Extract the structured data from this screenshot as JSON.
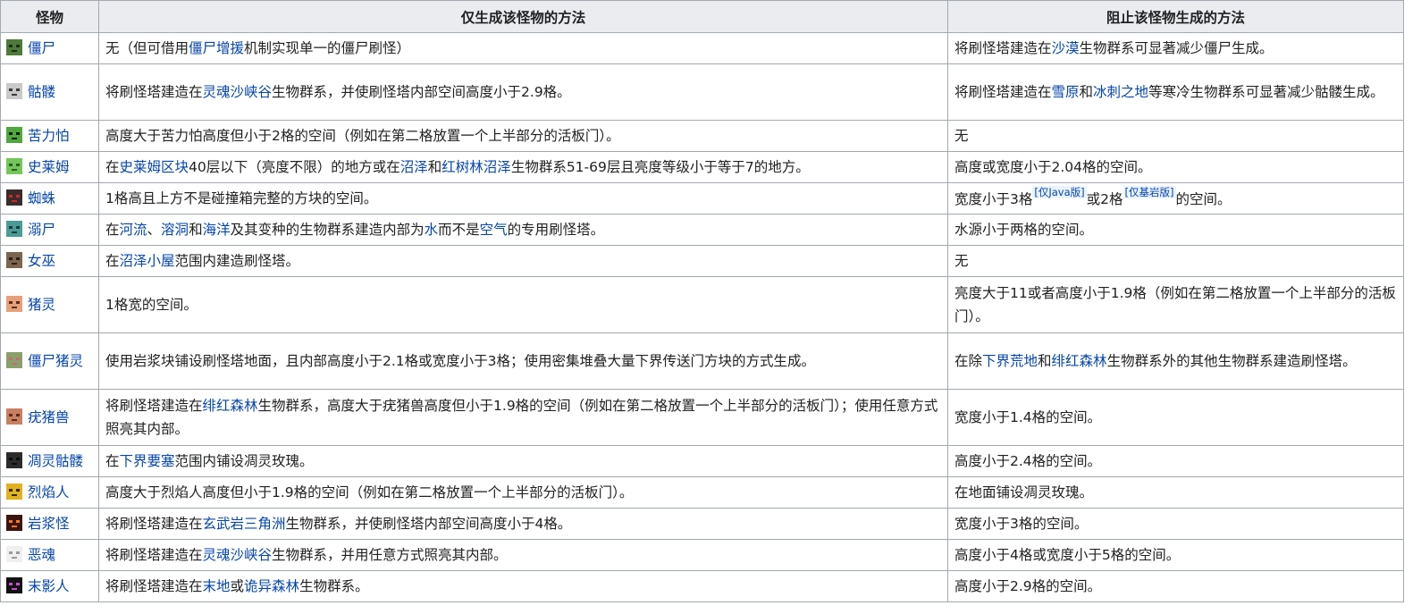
{
  "headers": {
    "mob": "怪物",
    "only": "仅生成该怪物的方法",
    "prevent": "阻止该怪物生成的方法"
  },
  "rows": [
    {
      "icon": "zombie-face-icon",
      "name": "僵尸",
      "only": [
        {
          "t": "无（但可借用"
        },
        {
          "t": "僵尸增援",
          "l": 1
        },
        {
          "t": "机制实现单一的僵尸刷怪）"
        }
      ],
      "prevent": [
        {
          "t": "将刷怪塔建造在"
        },
        {
          "t": "沙漠",
          "l": 1
        },
        {
          "t": "生物群系可显著减少僵尸生成。"
        }
      ]
    },
    {
      "icon": "skeleton-face-icon",
      "name": "骷髅",
      "only": [
        {
          "t": "将刷怪塔建造在"
        },
        {
          "t": "灵魂沙峡谷",
          "l": 1
        },
        {
          "t": "生物群系，并使刷怪塔内部空间高度小于2.9格。"
        }
      ],
      "prevent": [
        {
          "t": "将刷怪塔建造在"
        },
        {
          "t": "雪原",
          "l": 1
        },
        {
          "t": "和"
        },
        {
          "t": "冰刺之地",
          "l": 1
        },
        {
          "t": "等寒冷生物群系可显著减少骷髅生成。"
        }
      ]
    },
    {
      "icon": "creeper-face-icon",
      "name": "苦力怕",
      "only": [
        {
          "t": "高度大于苦力怕高度但小于2格的空间（例如在第二格放置一个上半部分的活板门）。"
        }
      ],
      "prevent": [
        {
          "t": "无"
        }
      ]
    },
    {
      "icon": "slime-face-icon",
      "name": "史莱姆",
      "only": [
        {
          "t": "在"
        },
        {
          "t": "史莱姆区块",
          "l": 1
        },
        {
          "t": "40层以下（亮度不限）的地方或在"
        },
        {
          "t": "沼泽",
          "l": 1
        },
        {
          "t": "和"
        },
        {
          "t": "红树林沼泽",
          "l": 1
        },
        {
          "t": "生物群系51-69层且亮度等级小于等于7的地方。"
        }
      ],
      "prevent": [
        {
          "t": "高度或宽度小于2.04格的空间。"
        }
      ]
    },
    {
      "icon": "spider-face-icon",
      "name": "蜘蛛",
      "only": [
        {
          "t": "1格高且上方不是碰撞箱完整的方块的空间。"
        }
      ],
      "prevent": [
        {
          "t": "宽度小于3格"
        },
        {
          "t": "[仅Java版]",
          "s": 1
        },
        {
          "t": "或2格"
        },
        {
          "t": "[仅基岩版]",
          "s": 1
        },
        {
          "t": "的空间。"
        }
      ]
    },
    {
      "icon": "drowned-face-icon",
      "name": "溺尸",
      "only": [
        {
          "t": "在"
        },
        {
          "t": "河流",
          "l": 1
        },
        {
          "t": "、"
        },
        {
          "t": "溶洞",
          "l": 1
        },
        {
          "t": "和"
        },
        {
          "t": "海洋",
          "l": 1
        },
        {
          "t": "及其变种的生物群系建造内部为"
        },
        {
          "t": "水",
          "l": 1
        },
        {
          "t": "而不是"
        },
        {
          "t": "空气",
          "l": 1
        },
        {
          "t": "的专用刷怪塔。"
        }
      ],
      "prevent": [
        {
          "t": "水源小于两格的空间。"
        }
      ]
    },
    {
      "icon": "witch-face-icon",
      "name": "女巫",
      "only": [
        {
          "t": "在"
        },
        {
          "t": "沼泽小屋",
          "l": 1
        },
        {
          "t": "范围内建造刷怪塔。"
        }
      ],
      "prevent": [
        {
          "t": "无"
        }
      ]
    },
    {
      "icon": "piglin-face-icon",
      "name": "猪灵",
      "only": [
        {
          "t": "1格宽的空间。"
        }
      ],
      "prevent": [
        {
          "t": "亮度大于11或者高度小于1.9格（例如在第二格放置一个上半部分的活板门）。"
        }
      ]
    },
    {
      "icon": "zombified-piglin-face-icon",
      "name": "僵尸猪灵",
      "only": [
        {
          "t": "使用岩浆块铺设刷怪塔地面，且内部高度小于2.1格或宽度小于3格；使用密集堆叠大量下界传送门方块的方式生成。"
        }
      ],
      "prevent": [
        {
          "t": "在除"
        },
        {
          "t": "下界荒地",
          "l": 1
        },
        {
          "t": "和"
        },
        {
          "t": "绯红森林",
          "l": 1
        },
        {
          "t": "生物群系外的其他生物群系建造刷怪塔。"
        }
      ]
    },
    {
      "icon": "hoglin-face-icon",
      "name": "疣猪兽",
      "only": [
        {
          "t": "将刷怪塔建造在"
        },
        {
          "t": "绯红森林",
          "l": 1
        },
        {
          "t": "生物群系，高度大于疣猪兽高度但小于1.9格的空间（例如在第二格放置一个上半部分的活板门）；使用任意方式照亮其内部。"
        }
      ],
      "prevent": [
        {
          "t": "宽度小于1.4格的空间。"
        }
      ]
    },
    {
      "icon": "wither-skeleton-face-icon",
      "name": "凋灵骷髅",
      "only": [
        {
          "t": "在"
        },
        {
          "t": "下界要塞",
          "l": 1
        },
        {
          "t": "范围内铺设凋灵玫瑰。"
        }
      ],
      "prevent": [
        {
          "t": "高度小于2.4格的空间。"
        }
      ]
    },
    {
      "icon": "blaze-face-icon",
      "name": "烈焰人",
      "only": [
        {
          "t": "高度大于烈焰人高度但小于1.9格的空间（例如在第二格放置一个上半部分的活板门）。"
        }
      ],
      "prevent": [
        {
          "t": "在地面铺设凋灵玫瑰。"
        }
      ]
    },
    {
      "icon": "magma-cube-face-icon",
      "name": "岩浆怪",
      "only": [
        {
          "t": "将刷怪塔建造在"
        },
        {
          "t": "玄武岩三角洲",
          "l": 1
        },
        {
          "t": "生物群系，并使刷怪塔内部空间高度小于4格。"
        }
      ],
      "prevent": [
        {
          "t": "宽度小于3格的空间。"
        }
      ]
    },
    {
      "icon": "ghast-face-icon",
      "name": "恶魂",
      "only": [
        {
          "t": "将刷怪塔建造在"
        },
        {
          "t": "灵魂沙峡谷",
          "l": 1
        },
        {
          "t": "生物群系，并用任意方式照亮其内部。"
        }
      ],
      "prevent": [
        {
          "t": "高度小于4格或宽度小于5格的空间。"
        }
      ]
    },
    {
      "icon": "enderman-face-icon",
      "name": "末影人",
      "only": [
        {
          "t": "将刷怪塔建造在"
        },
        {
          "t": "末地",
          "l": 1
        },
        {
          "t": "或"
        },
        {
          "t": "诡异森林",
          "l": 1
        },
        {
          "t": "生物群系。"
        }
      ],
      "prevent": [
        {
          "t": "高度小于2.9格的空间。"
        }
      ]
    }
  ]
}
